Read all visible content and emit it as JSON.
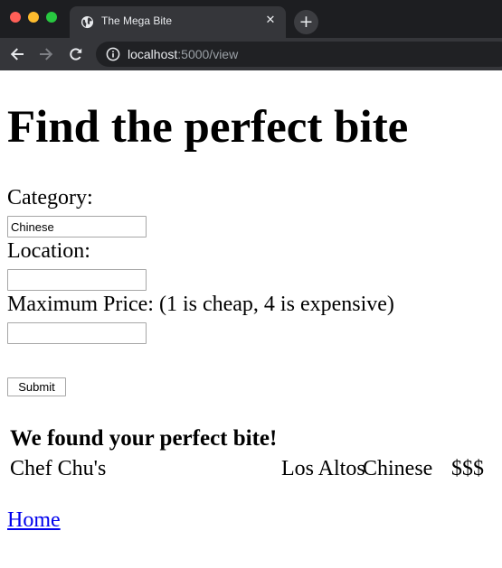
{
  "browser": {
    "tab_title": "The Mega Bite",
    "tab_close_glyph": "✕",
    "new_tab_glyph": "+",
    "url_host": "localhost",
    "url_rest": ":5000/view",
    "icons": [
      "globe-icon",
      "close-icon",
      "plus-icon",
      "back-arrow-icon",
      "forward-arrow-icon",
      "reload-icon",
      "info-icon"
    ]
  },
  "page": {
    "heading": "Find the perfect bite",
    "form": {
      "category_label": "Category:",
      "category_value": "Chinese",
      "location_label": "Location:",
      "location_value": "",
      "price_label": "Maximum Price: (1 is cheap, 4 is expensive)",
      "price_value": "",
      "submit_label": "Submit"
    },
    "results": {
      "title": "We found your perfect bite!",
      "rows": [
        {
          "name": "Chef Chu's",
          "location": "Los Altos",
          "category": "Chinese",
          "price": "$$$"
        }
      ]
    },
    "home_link": "Home"
  },
  "colors": {
    "link": "#0000ee",
    "chrome_dark": "#1d1e21",
    "tab_active": "#35363a"
  }
}
